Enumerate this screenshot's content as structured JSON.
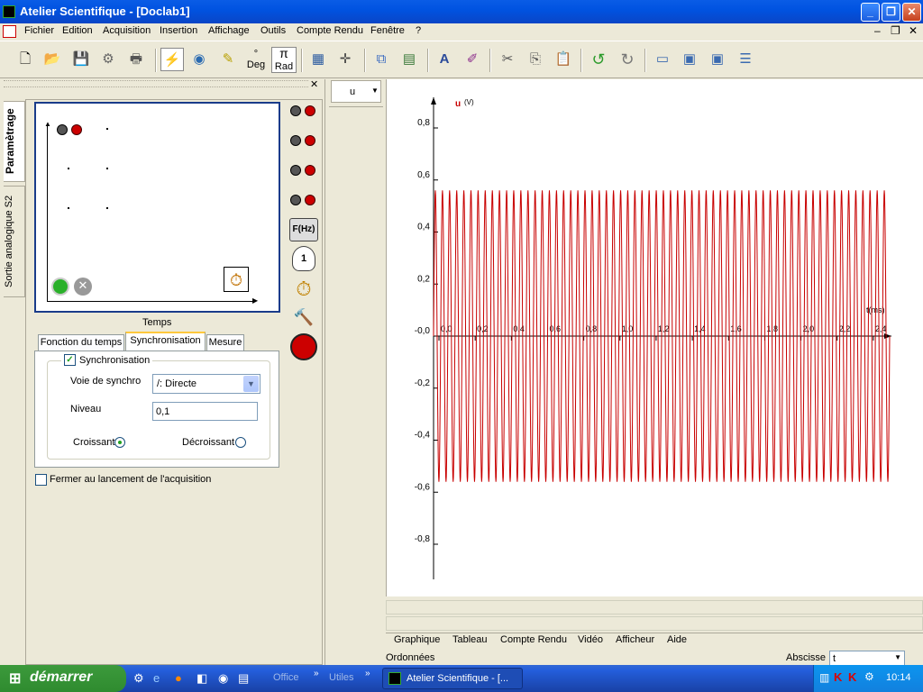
{
  "window": {
    "title": "Atelier Scientifique - [Doclab1]"
  },
  "menu": [
    "Fichier",
    "Edition",
    "Acquisition",
    "Insertion",
    "Affichage",
    "Outils",
    "Compte Rendu",
    "Fenêtre",
    "?"
  ],
  "toolbar": {
    "deg_label": "Deg",
    "deg_symbol": "°",
    "pi_symbol": "π",
    "rad_label": "Rad"
  },
  "left_tabs": {
    "parametrage": "Paramètrage",
    "sortie": "Sortie analogique S2"
  },
  "time_panel": {
    "label": "Temps",
    "f_label": "F(Hz)",
    "one": "1"
  },
  "tabs": [
    "Fonction du temps",
    "Synchronisation",
    "Mesure"
  ],
  "sync": {
    "checkbox_label": "Synchronisation",
    "voie_label": "Voie de synchro",
    "voie_value": "/: Directe",
    "niveau_label": "Niveau",
    "niveau_value": "0,1",
    "croissant_label": "Croissant",
    "decroissant_label": "Décroissant"
  },
  "close_checkbox_label": "Fermer au lancement de l'acquisition",
  "curve_selector": "u",
  "chart_data": {
    "type": "line",
    "series": [
      {
        "name": "u",
        "amplitude": 0.56,
        "periods_visible": 64
      }
    ],
    "ylabel": "u (V)",
    "xlabel": "t (ms)",
    "yticks": [
      "0,8",
      "0,6",
      "0,4",
      "0,2",
      "-0,0",
      "-0,2",
      "-0,4",
      "-0,6",
      "-0,8"
    ],
    "xticks": [
      "0,0",
      "0,2",
      "0,4",
      "0,6",
      "0,8",
      "1,0",
      "1,2",
      "1,4",
      "1,6",
      "1,8",
      "2,0",
      "2,2",
      "2,4"
    ],
    "ylim": [
      -0.95,
      0.95
    ],
    "xlim": [
      0,
      2.5
    ],
    "color": "#c80000",
    "grid": false
  },
  "bottom_tabs": [
    "Graphique",
    "Tableau",
    "Compte Rendu",
    "Vidéo",
    "Afficheur",
    "Aide"
  ],
  "status": {
    "ordonnees": "Ordonnées",
    "abscisse_label": "Abscisse",
    "abscisse_value": "t"
  },
  "taskbar": {
    "start": "démarrer",
    "office": "Office",
    "utiles": "Utiles",
    "app": "Atelier Scientifique - [...",
    "clock": "10:14"
  }
}
